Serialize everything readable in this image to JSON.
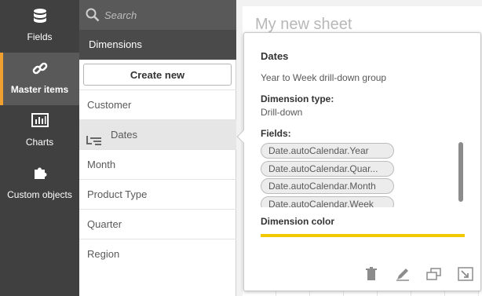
{
  "rail": {
    "items": [
      {
        "label": "Fields",
        "icon": "database-icon"
      },
      {
        "label": "Master items",
        "icon": "link-icon",
        "active": true
      },
      {
        "label": "Charts",
        "icon": "bar-chart-icon"
      },
      {
        "label": "Custom objects",
        "icon": "puzzle-icon"
      }
    ]
  },
  "panel": {
    "search_placeholder": "Search",
    "section_title": "Dimensions",
    "create_label": "Create new",
    "items": [
      "Customer",
      "Dates",
      "Month",
      "Product Type",
      "Quarter",
      "Region"
    ],
    "selected_index": 1
  },
  "sheet": {
    "title": "My new sheet"
  },
  "popover": {
    "title": "Dates",
    "description": "Year to Week drill-down group",
    "type_heading": "Dimension type:",
    "type_value": "Drill-down",
    "fields_heading": "Fields:",
    "fields": [
      "Date.autoCalendar.Year",
      "Date.autoCalendar.Quar...",
      "Date.autoCalendar.Month",
      "Date.autoCalendar.Week"
    ],
    "color_heading": "Dimension color",
    "color_value": "#f2c800",
    "actions": [
      "trash-icon",
      "edit-icon",
      "duplicate-icon",
      "expand-icon"
    ]
  }
}
